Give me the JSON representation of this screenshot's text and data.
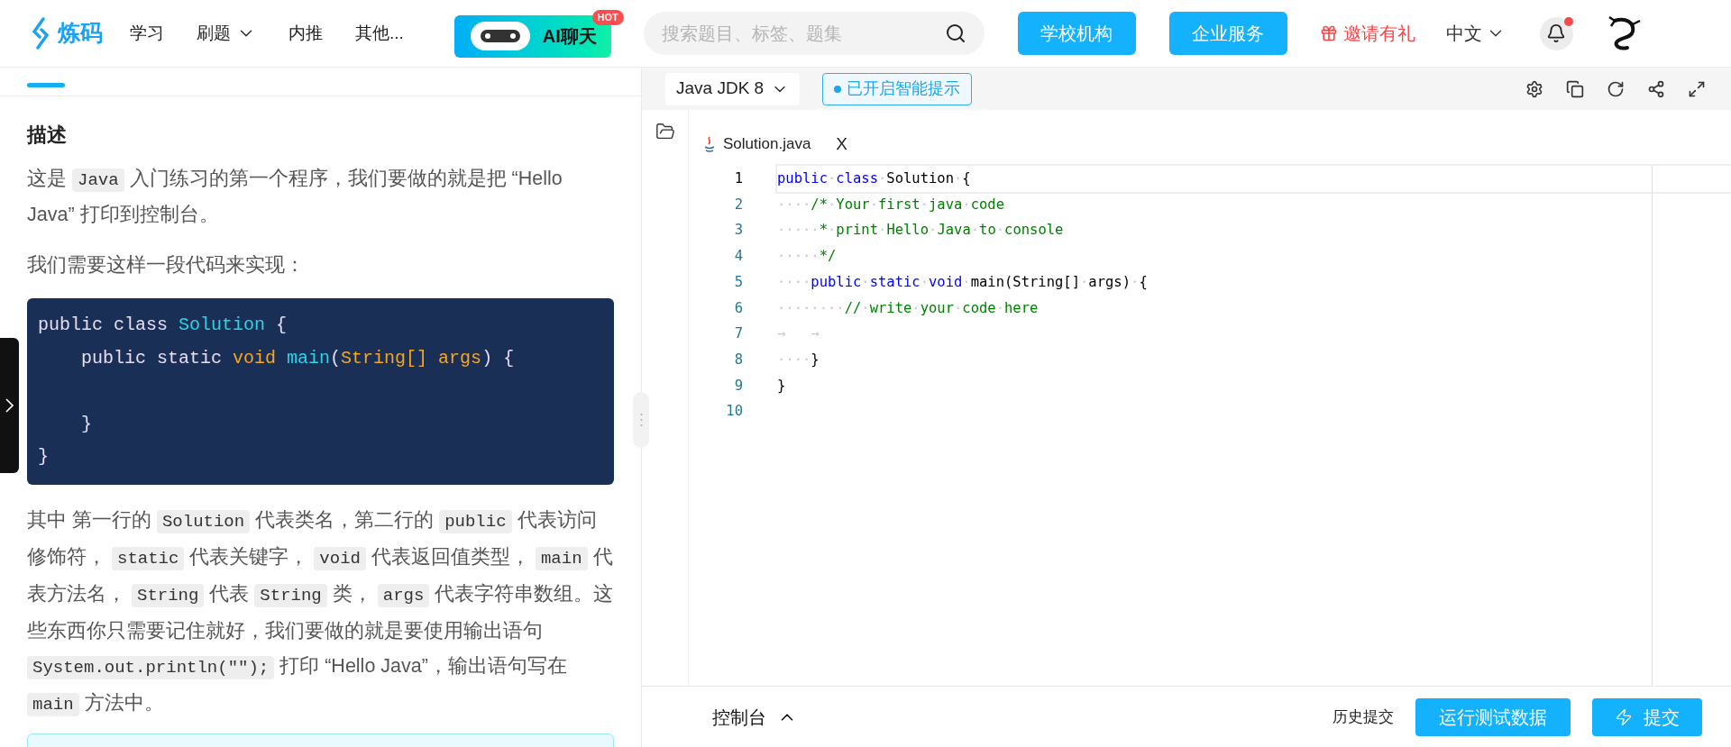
{
  "header": {
    "logo": "炼码",
    "nav": [
      {
        "label": "学习",
        "dropdown": false
      },
      {
        "label": "刷题",
        "dropdown": true
      },
      {
        "label": "内推",
        "dropdown": false
      },
      {
        "label": "其他...",
        "dropdown": false
      }
    ],
    "ai_button": {
      "label": "AI聊天",
      "badge": "HOT"
    },
    "search": {
      "placeholder": "搜索题目、标签、题集"
    },
    "buttons": [
      "学校机构",
      "企业服务"
    ],
    "invite": "邀请有礼",
    "language": "中文",
    "notification_dot": true
  },
  "problem": {
    "heading": "描述",
    "paragraphs": [
      [
        {
          "kind": "text",
          "text": "这是 "
        },
        {
          "kind": "code",
          "text": "Java"
        },
        {
          "kind": "text",
          "text": " 入门练习的第一个程序，我们要做的就是把 “Hello Java” 打印到控制台。"
        }
      ],
      [
        {
          "kind": "text",
          "text": "我们需要这样一段代码来实现："
        }
      ]
    ],
    "code_block": [
      {
        "kind": "plain",
        "text": "public class "
      },
      {
        "kind": "name",
        "text": "Solution"
      },
      {
        "kind": "plain",
        "text": " {\n    public static "
      },
      {
        "kind": "type",
        "text": "void"
      },
      {
        "kind": "name",
        "text": " main"
      },
      {
        "kind": "plain",
        "text": "("
      },
      {
        "kind": "type",
        "text": "String[] args"
      },
      {
        "kind": "plain",
        "text": ") {\n\n    }\n}"
      }
    ],
    "explanation": [
      {
        "kind": "text",
        "text": "其中 第一行的 "
      },
      {
        "kind": "code",
        "text": "Solution"
      },
      {
        "kind": "text",
        "text": " 代表类名，第二行的 "
      },
      {
        "kind": "code",
        "text": "public"
      },
      {
        "kind": "text",
        "text": " 代表访问修饰符， "
      },
      {
        "kind": "code",
        "text": "static"
      },
      {
        "kind": "text",
        "text": " 代表关键字， "
      },
      {
        "kind": "code",
        "text": "void"
      },
      {
        "kind": "text",
        "text": " 代表返回值类型， "
      },
      {
        "kind": "code",
        "text": "main"
      },
      {
        "kind": "text",
        "text": " 代表方法名， "
      },
      {
        "kind": "code",
        "text": "String"
      },
      {
        "kind": "text",
        "text": " 代表 "
      },
      {
        "kind": "code",
        "text": "String"
      },
      {
        "kind": "text",
        "text": " 类， "
      },
      {
        "kind": "code",
        "text": "args"
      },
      {
        "kind": "text",
        "text": " 代表字符串数组。这些东西你只需要记住就好，我们要做的就是要使用输出语句 "
      },
      {
        "kind": "code",
        "text": "System.out.println(\"\");"
      },
      {
        "kind": "text",
        "text": " 打印 “Hello Java”，输出语句写在 "
      },
      {
        "kind": "code",
        "text": "main"
      },
      {
        "kind": "text",
        "text": " 方法中。"
      }
    ]
  },
  "editor": {
    "language": "Java JDK 8",
    "smart_hint": "已开启智能提示",
    "file_tab": "Solution.java",
    "close": "X",
    "lines": [
      {
        "number": "1",
        "selected": true,
        "tokens": [
          {
            "kind": "keyword",
            "text": "public"
          },
          {
            "kind": "space",
            "text": "·"
          },
          {
            "kind": "keyword",
            "text": "class"
          },
          {
            "kind": "space",
            "text": "·"
          },
          {
            "kind": "plain",
            "text": "Solution"
          },
          {
            "kind": "space",
            "text": "·"
          },
          {
            "kind": "plain",
            "text": "{"
          }
        ]
      },
      {
        "number": "2",
        "selected": false,
        "tokens": [
          {
            "kind": "space",
            "text": "····"
          },
          {
            "kind": "comment",
            "text": "/*"
          },
          {
            "kind": "space",
            "text": "·"
          },
          {
            "kind": "comment",
            "text": "Your"
          },
          {
            "kind": "space",
            "text": "·"
          },
          {
            "kind": "comment",
            "text": "first"
          },
          {
            "kind": "space",
            "text": "·"
          },
          {
            "kind": "comment",
            "text": "java"
          },
          {
            "kind": "space",
            "text": "·"
          },
          {
            "kind": "comment",
            "text": "code"
          }
        ]
      },
      {
        "number": "3",
        "selected": false,
        "tokens": [
          {
            "kind": "space",
            "text": "·····"
          },
          {
            "kind": "comment",
            "text": "*"
          },
          {
            "kind": "space",
            "text": "·"
          },
          {
            "kind": "comment",
            "text": "print"
          },
          {
            "kind": "space",
            "text": "·"
          },
          {
            "kind": "comment",
            "text": "Hello"
          },
          {
            "kind": "space",
            "text": "·"
          },
          {
            "kind": "comment",
            "text": "Java"
          },
          {
            "kind": "space",
            "text": "·"
          },
          {
            "kind": "comment",
            "text": "to"
          },
          {
            "kind": "space",
            "text": "·"
          },
          {
            "kind": "comment",
            "text": "console"
          }
        ]
      },
      {
        "number": "4",
        "selected": false,
        "tokens": [
          {
            "kind": "space",
            "text": "·····"
          },
          {
            "kind": "comment",
            "text": "*/"
          }
        ]
      },
      {
        "number": "5",
        "selected": false,
        "tokens": [
          {
            "kind": "space",
            "text": "····"
          },
          {
            "kind": "keyword",
            "text": "public"
          },
          {
            "kind": "space",
            "text": "·"
          },
          {
            "kind": "keyword",
            "text": "static"
          },
          {
            "kind": "space",
            "text": "·"
          },
          {
            "kind": "keyword",
            "text": "void"
          },
          {
            "kind": "space",
            "text": "·"
          },
          {
            "kind": "plain",
            "text": "main(String[]"
          },
          {
            "kind": "space",
            "text": "·"
          },
          {
            "kind": "plain",
            "text": "args)"
          },
          {
            "kind": "space",
            "text": "·"
          },
          {
            "kind": "plain",
            "text": "{"
          }
        ]
      },
      {
        "number": "6",
        "selected": false,
        "tokens": [
          {
            "kind": "space",
            "text": "········"
          },
          {
            "kind": "comment",
            "text": "//"
          },
          {
            "kind": "space",
            "text": "·"
          },
          {
            "kind": "comment",
            "text": "write"
          },
          {
            "kind": "space",
            "text": "·"
          },
          {
            "kind": "comment",
            "text": "your"
          },
          {
            "kind": "space",
            "text": "·"
          },
          {
            "kind": "comment",
            "text": "code"
          },
          {
            "kind": "space",
            "text": "·"
          },
          {
            "kind": "comment",
            "text": "here"
          }
        ]
      },
      {
        "number": "7",
        "selected": false,
        "tokens": [
          {
            "kind": "space",
            "text": "→   →"
          }
        ]
      },
      {
        "number": "8",
        "selected": false,
        "tokens": [
          {
            "kind": "space",
            "text": "····"
          },
          {
            "kind": "plain",
            "text": "}"
          }
        ]
      },
      {
        "number": "9",
        "selected": false,
        "tokens": [
          {
            "kind": "plain",
            "text": "}"
          }
        ]
      },
      {
        "number": "10",
        "selected": false
      }
    ]
  },
  "footer": {
    "console": "控制台",
    "history": "历史提交",
    "run": "运行测试数据",
    "submit": "提交"
  }
}
